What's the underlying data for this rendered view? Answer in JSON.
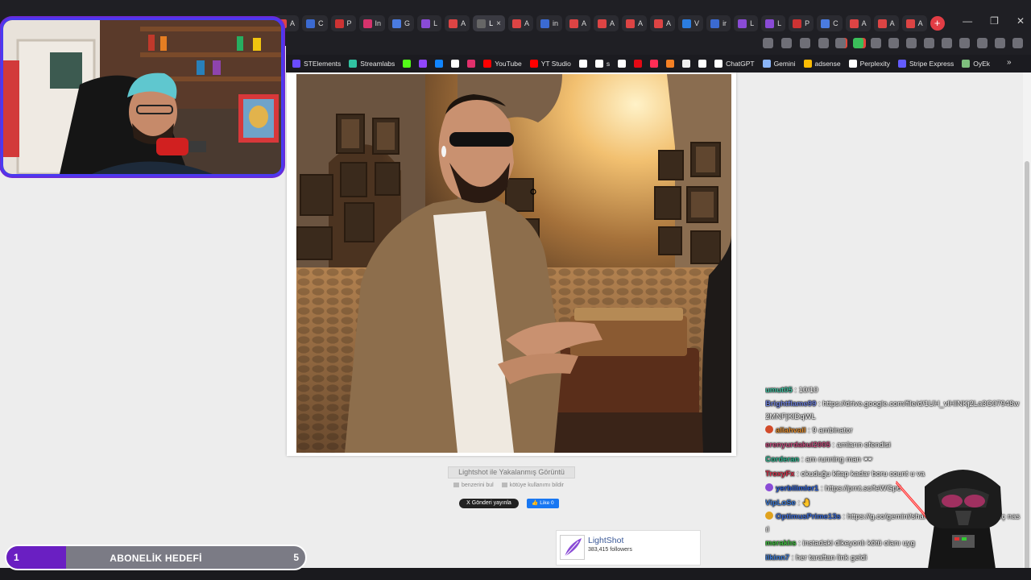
{
  "browser": {
    "tabs": [
      {
        "label": "A",
        "color": "#d44"
      },
      {
        "label": "C",
        "color": "#3b6ad1"
      },
      {
        "label": "P",
        "color": "#c33"
      },
      {
        "label": "In",
        "color": "#d6336c"
      },
      {
        "label": "G",
        "color": "#4a7be0"
      },
      {
        "label": "L",
        "color": "#8a4bd6"
      },
      {
        "label": "A",
        "color": "#d44"
      },
      {
        "label": "L",
        "color": "#666",
        "active": true
      },
      {
        "label": "A",
        "color": "#d44"
      },
      {
        "label": "in",
        "color": "#3b6ad1"
      },
      {
        "label": "A",
        "color": "#d44"
      },
      {
        "label": "A",
        "color": "#d44"
      },
      {
        "label": "A",
        "color": "#d44"
      },
      {
        "label": "A",
        "color": "#d44"
      },
      {
        "label": "V",
        "color": "#2b7de0"
      },
      {
        "label": "ir",
        "color": "#3b6ad1"
      },
      {
        "label": "L",
        "color": "#8a4bd6"
      },
      {
        "label": "L",
        "color": "#8a4bd6"
      },
      {
        "label": "P",
        "color": "#c33"
      },
      {
        "label": "C",
        "color": "#4a7be0"
      },
      {
        "label": "A",
        "color": "#d44"
      },
      {
        "label": "A",
        "color": "#d44"
      },
      {
        "label": "A",
        "color": "#d44"
      }
    ],
    "active_tab_close": "×",
    "new_tab": "+",
    "window_controls": {
      "minimize": "—",
      "maximize": "❐",
      "close": "✕"
    }
  },
  "bookmarks": [
    {
      "label": "STElements",
      "color": "#6a4bff"
    },
    {
      "label": "Streamlabs",
      "color": "#31c3a2"
    },
    {
      "label": "",
      "color": "#53fc18"
    },
    {
      "label": "",
      "color": "#9146ff"
    },
    {
      "label": "",
      "color": "#1185fe"
    },
    {
      "label": "",
      "color": "#ffffff"
    },
    {
      "label": "",
      "color": "#e1306c"
    },
    {
      "label": "YouTube",
      "color": "#ff0000"
    },
    {
      "label": "YT Studio",
      "color": "#ff0000"
    },
    {
      "label": "",
      "color": "#ffffff"
    },
    {
      "label": "s",
      "color": "#ffffff"
    },
    {
      "label": "",
      "color": "#ffffff"
    },
    {
      "label": "",
      "color": "#e50914"
    },
    {
      "label": "",
      "color": "#ff2d55"
    },
    {
      "label": "",
      "color": "#f48024"
    },
    {
      "label": "",
      "color": "#eeeeee"
    },
    {
      "label": "",
      "color": "#ffffff"
    },
    {
      "label": "ChatGPT",
      "color": "#ffffff"
    },
    {
      "label": "Gemini",
      "color": "#8ab4f8"
    },
    {
      "label": "adsense",
      "color": "#fbbc04"
    },
    {
      "label": "Perplexity",
      "color": "#ffffff"
    },
    {
      "label": "Stripe Express",
      "color": "#635bff"
    },
    {
      "label": "OyEk",
      "color": "#7ec07e"
    }
  ],
  "bookmarks_more": "»",
  "lightshot": {
    "caption": "Lightshot ile Yakalanmış Görüntü",
    "link_similar": "benzerini bul",
    "link_report": "kötüye kullanımı bildir",
    "post_button": "X  Gönderi yayınla",
    "like_button": "👍 Like 0",
    "page_name": "LightShot",
    "followers": "383,415 followers"
  },
  "chat": [
    {
      "user": "umut05",
      "color": "#3fbf9f",
      "msg": " : 10/10"
    },
    {
      "user": "Brightflame99",
      "color": "#6d7fd6",
      "msg": " : https://drive.google.com/file/d/1UH_vlHINKj2La3G07948w2MNFjKlDqWL",
      "wrap": true
    },
    {
      "user": "aliahvail",
      "color": "#e08a2a",
      "msg": " : 9 ambinator",
      "icon": "#d24b2a"
    },
    {
      "user": "erenyurdakul2005",
      "color": "#c04a7a",
      "msg": " : amların efendisi"
    },
    {
      "user": "Corderan",
      "color": "#2fb58f",
      "msg": " : am running man 🕶"
    },
    {
      "user": "TroxyFx",
      "color": "#d2324b",
      "msg": " : okuduğu kitap kadar boru count u va"
    },
    {
      "user": "yerbilimler1",
      "color": "#2c5fd4",
      "msg": " : https://prnt.sc/feWGp6",
      "icon": "#8a4bd6"
    },
    {
      "user": "VipLoSe",
      "color": "#3c7ad6",
      "msg": " : 🤚"
    },
    {
      "user": "OptimusPrime13s",
      "color": "#3b6ad1",
      "msg": " : https://g.co/gemini/share/465 senin funkon abç nasıl",
      "icon": "#e0a21e",
      "wrap": true
    },
    {
      "user": "meraklıs",
      "color": "#3fbf3f",
      "msg": " : instadaki dikeyonlı kötü olanı uyg"
    },
    {
      "user": "ilkinn7",
      "color": "#3a7ad6",
      "msg": " : her taraftan link geldi"
    }
  ],
  "sub_goal": {
    "current": "1",
    "title": "ABONELİK HEDEFİ",
    "target": "5",
    "progress": 0.2,
    "fill_color": "#6a1fc2"
  }
}
